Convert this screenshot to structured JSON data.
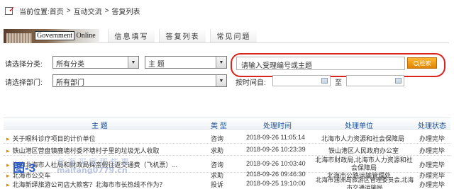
{
  "breadcrumb": {
    "prefix": "当前位置:",
    "items": [
      "首页",
      "互动交流",
      "答复列表"
    ],
    "sep": ">"
  },
  "nav": {
    "logo_gov": "Government",
    "logo_online": "Online",
    "tabs": [
      "信息填写",
      "答复列表",
      "常见问题"
    ]
  },
  "filters": {
    "category_label": "请选择分类:",
    "category_value": "所有分类",
    "subject_value": "主 题",
    "department_label": "请选择部门:",
    "department_value": "所有部门",
    "time_from_label": "按时间自:",
    "time_to_label": "至",
    "search_value": "请输入受理编号或主题",
    "search_button": "检索"
  },
  "table": {
    "headers": [
      "主 题",
      "类 型",
      "处理时间",
      "处理单位",
      "处理状态"
    ],
    "rows": [
      {
        "subject": "关于眼科诊疗项目的计价单位",
        "type": "咨询",
        "time": "2018-09-26 11:05:14",
        "org": "北海市人力资源和社会保障局",
        "status": "办理完毕"
      },
      {
        "subject": "铁山港区营盘镇鹿塘村委坏塘村子里的垃圾无人收取",
        "type": "求助",
        "time": "2018-09-26 10:23:39",
        "org": "铁山港区人民政府办公室",
        "status": "办理完毕"
      },
      {
        "subject": "咨询北海市人社局和财政局探亲假往返交通费（飞机票）...",
        "type": "咨询",
        "time": "2018-09-26 10:03:40",
        "org": "北海市财政局,北海市人力资源和社会保障局",
        "status": "办理完毕"
      },
      {
        "subject": "北海市公交车",
        "type": "求助",
        "time": "2018-09-26 09:46:30",
        "org": "北海市公路运输管理处",
        "status": "办理完毕"
      },
      {
        "subject": "北海新绎旅游公司店大欺客？北海市市长热线不作为？",
        "type": "投诉",
        "time": "2018-09-25 19:10:00",
        "org": "北海市涠洲岛旅游区管理委员会,北海市交通运输局",
        "status": "办理完毕"
      }
    ]
  },
  "watermark": {
    "figure": "图-3",
    "site_cn": "北海买房那些事",
    "site_url": "maifang0779.cn"
  }
}
